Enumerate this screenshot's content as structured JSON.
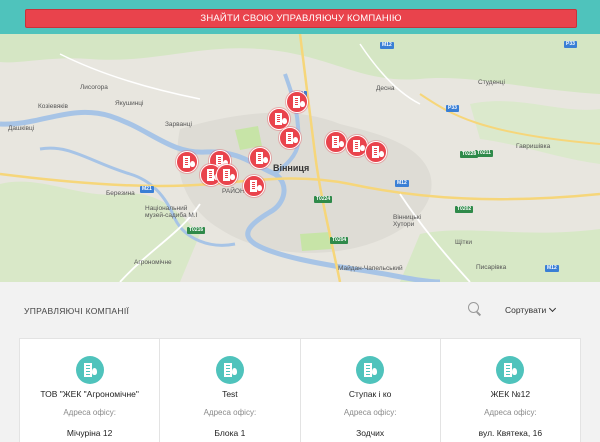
{
  "cta": {
    "label": "ЗНАЙТИ СВОЮ УПРАВЛЯЮЧУ КОМПАНІЮ"
  },
  "map": {
    "city": "Вінниця",
    "places": {
      "lysogora": "Лисогора",
      "yakushyntsi": "Якушинці",
      "kozhevyaky": "Козіевяків",
      "daschkovtsi": "Дашківці",
      "zarvantsi": "Зарванці",
      "desna": "Десна",
      "studentsi": "Студенці",
      "havryshivka": "Гавришівка",
      "berezyna": "Березина",
      "museum": "Національний музей-садиба М.І",
      "ahronomichne": "Агрономічне",
      "vinnytski_khutory": "Вінницькі Хутори",
      "schytky": "Щітки",
      "pysarivka": "Писарівка",
      "maidan": "Майдан-Чапельський",
      "zodchykh": "Зодчих",
      "raion": "РАЙОН"
    },
    "roads": [
      "M21",
      "M12",
      "M12",
      "P33",
      "T0211",
      "T0216",
      "T0224",
      "T0204",
      "M21",
      "T0202",
      "T0228",
      "M12",
      "P33"
    ]
  },
  "list": {
    "title": "УПРАВЛЯЮЧІ КОМПАНІЇ",
    "sort_label": "Сортувати"
  },
  "cards": [
    {
      "name": "ТОВ \"ЖЕК \"Агрономічне\"",
      "addr_label": "Адреса офісу:",
      "addr": "Мічуріна 12"
    },
    {
      "name": "Test",
      "addr_label": "Адреса офісу:",
      "addr": "Блока 1"
    },
    {
      "name": "Ступак і ко",
      "addr_label": "Адреса офісу:",
      "addr": "Зодчих"
    },
    {
      "name": "ЖЕК №12",
      "addr_label": "Адреса офісу:",
      "addr": "вул. Квятека, 16"
    }
  ],
  "colors": {
    "teal": "#4fc3bc",
    "red": "#e9434c",
    "water": "#a7c4e6",
    "park": "#c7e4a7"
  }
}
